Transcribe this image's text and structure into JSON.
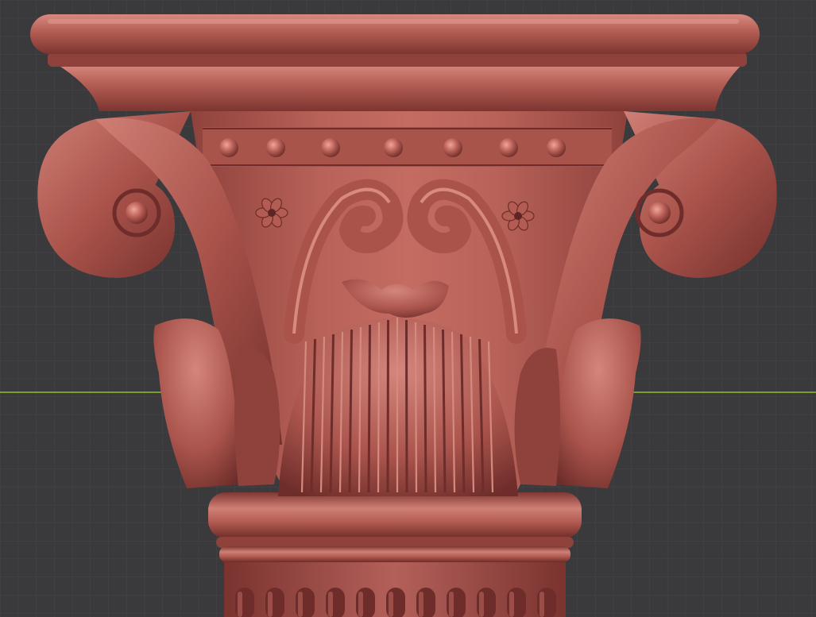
{
  "viewport": {
    "background_color": "#3a3a3c",
    "grid_minor_color": "#46474a",
    "grid_major_color": "#2b2b2d",
    "horizon_axis_color": "#8fbf2a",
    "grid_visible": true,
    "horizon_axis_visible": true
  },
  "model": {
    "subject": "corinthian-column-capital",
    "material_color": "#b05a52",
    "shadow_color": "#6e2d2a",
    "highlight_color": "#dd8a80",
    "elements": [
      "abacus",
      "bead-row",
      "volutes",
      "rosettes",
      "acanthus-leaves",
      "central-fan-leaf",
      "astragal-ring",
      "fluted-shaft"
    ]
  }
}
